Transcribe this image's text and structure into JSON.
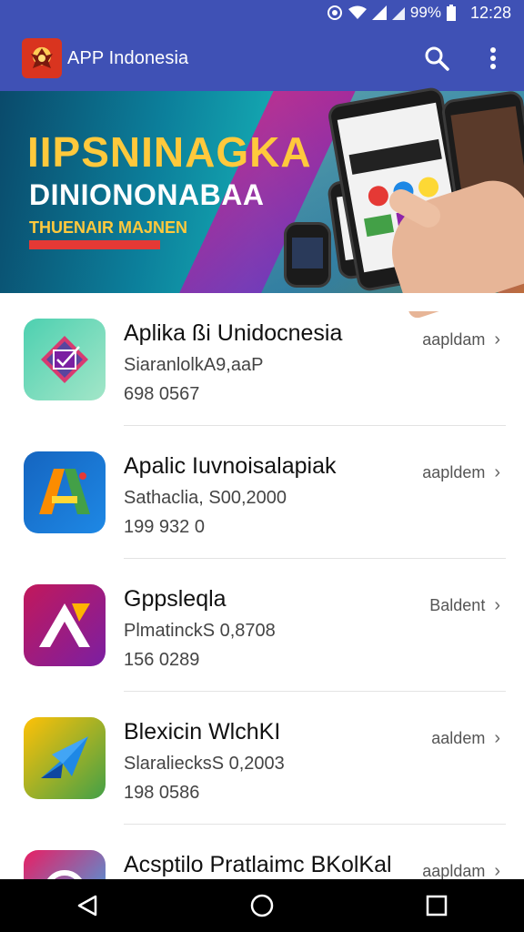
{
  "status_bar": {
    "battery": "99%",
    "time": "12:28"
  },
  "app_bar": {
    "title": "APP Indonesia"
  },
  "banner": {
    "headline": "IIPSNINAGKA",
    "subheadline": "DINIONONABAA",
    "tagline": "THUENAIR MAJNEN"
  },
  "apps": [
    {
      "name": "Aplika ßi Unidocnesia",
      "subtitle": "SiaranlolkA9,aaP",
      "count": "698 0567",
      "action": "aapldam",
      "icon": "check-square-icon",
      "colors": {
        "from": "#4dd0b0",
        "to": "#a3e6c8"
      }
    },
    {
      "name": "Apalic Iuvnoisalapiak",
      "subtitle": "Sathaclia, S00,2000",
      "count": "199 932 0",
      "action": "aapldem",
      "icon": "letter-a-icon",
      "colors": {
        "from": "#1565c0",
        "to": "#1e88e5"
      }
    },
    {
      "name": "Gppsleqla",
      "subtitle": "PlmatinckS 0,8708",
      "count": "156 0289",
      "action": "Baldent",
      "icon": "triangle-a-icon",
      "colors": {
        "from": "#c2185b",
        "to": "#7b1fa2"
      }
    },
    {
      "name": "Blexicin WlchKI",
      "subtitle": "SlaraliecksS 0,2003",
      "count": "198 0586",
      "action": "aaldem",
      "icon": "paper-plane-icon",
      "colors": {
        "from": "#ffc107",
        "to": "#43a047"
      }
    },
    {
      "name": "Acsptilo Pratlaimc BKolKal",
      "subtitle": "",
      "count": "",
      "action": "aapldam",
      "icon": "circle-app-icon",
      "colors": {
        "from": "#e91e63",
        "to": "#29b6f6"
      }
    }
  ],
  "colors": {
    "primary": "#3f51b5",
    "banner_yellow": "#ffc93c",
    "banner_red": "#e53935"
  }
}
